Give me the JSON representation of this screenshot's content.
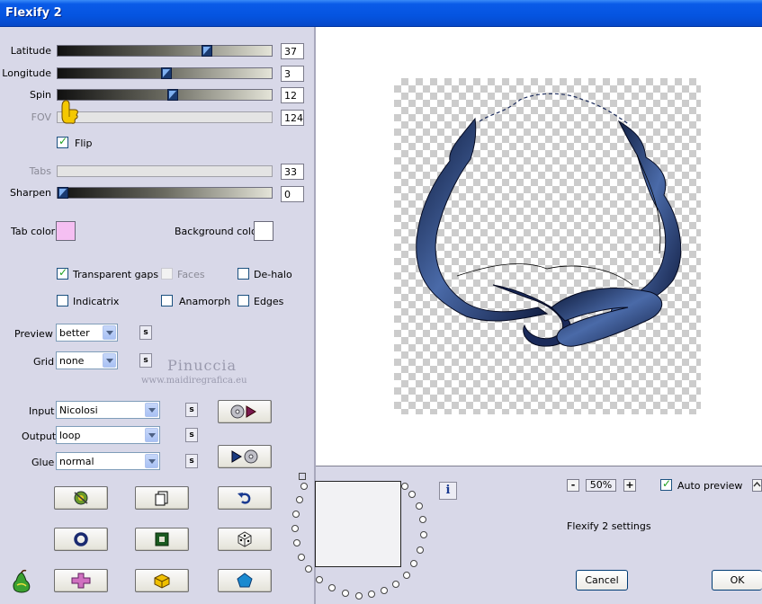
{
  "window": {
    "title": "Flexify 2"
  },
  "sliders": {
    "latitude": {
      "label": "Latitude",
      "value": "37",
      "level": 0.72
    },
    "longitude": {
      "label": "Longitude",
      "value": "3",
      "level": 0.5
    },
    "spin": {
      "label": "Spin",
      "value": "12",
      "level": 0.53
    },
    "fov": {
      "label": "FOV",
      "value": "124",
      "level": 0.0,
      "disabled": true
    },
    "tabs": {
      "label": "Tabs",
      "value": "33",
      "disabled": true
    },
    "sharpen": {
      "label": "Sharpen",
      "value": "0",
      "level": 0.0
    }
  },
  "flip": {
    "label": "Flip",
    "checked": true
  },
  "colors": {
    "tab_color_label": "Tab color",
    "tab_color": "#f5bff2",
    "background_color_label": "Background color",
    "background_color": "#ffffff"
  },
  "options": {
    "transparent_gaps": {
      "label": "Transparent gaps",
      "checked": true
    },
    "faces": {
      "label": "Faces",
      "checked": false,
      "disabled": true
    },
    "de_halo": {
      "label": "De-halo",
      "checked": false
    },
    "indicatrix": {
      "label": "Indicatrix",
      "checked": false
    },
    "anamorph": {
      "label": "Anamorph",
      "checked": false
    },
    "edges": {
      "label": "Edges",
      "checked": false
    }
  },
  "selects": {
    "preview": {
      "label": "Preview",
      "value": "better"
    },
    "grid": {
      "label": "Grid",
      "value": "none"
    },
    "input": {
      "label": "Input",
      "value": "Nicolosi"
    },
    "output": {
      "label": "Output",
      "value": "loop"
    },
    "glue": {
      "label": "Glue",
      "value": "normal"
    }
  },
  "s_button_label": "s",
  "watermark": {
    "name": "Pinuccia",
    "url": "www.maidiregrafica.eu"
  },
  "zoom": {
    "minus": "-",
    "value": "50%",
    "plus": "+"
  },
  "auto_preview": {
    "label": "Auto preview",
    "checked": true
  },
  "settings_label": "Flexify 2 settings",
  "info_label": "i",
  "buttons": {
    "cancel": "Cancel",
    "ok": "OK"
  },
  "colors_ui": {
    "accent_blue": "#0554e0",
    "frame_navy": "#1a2a5a"
  }
}
